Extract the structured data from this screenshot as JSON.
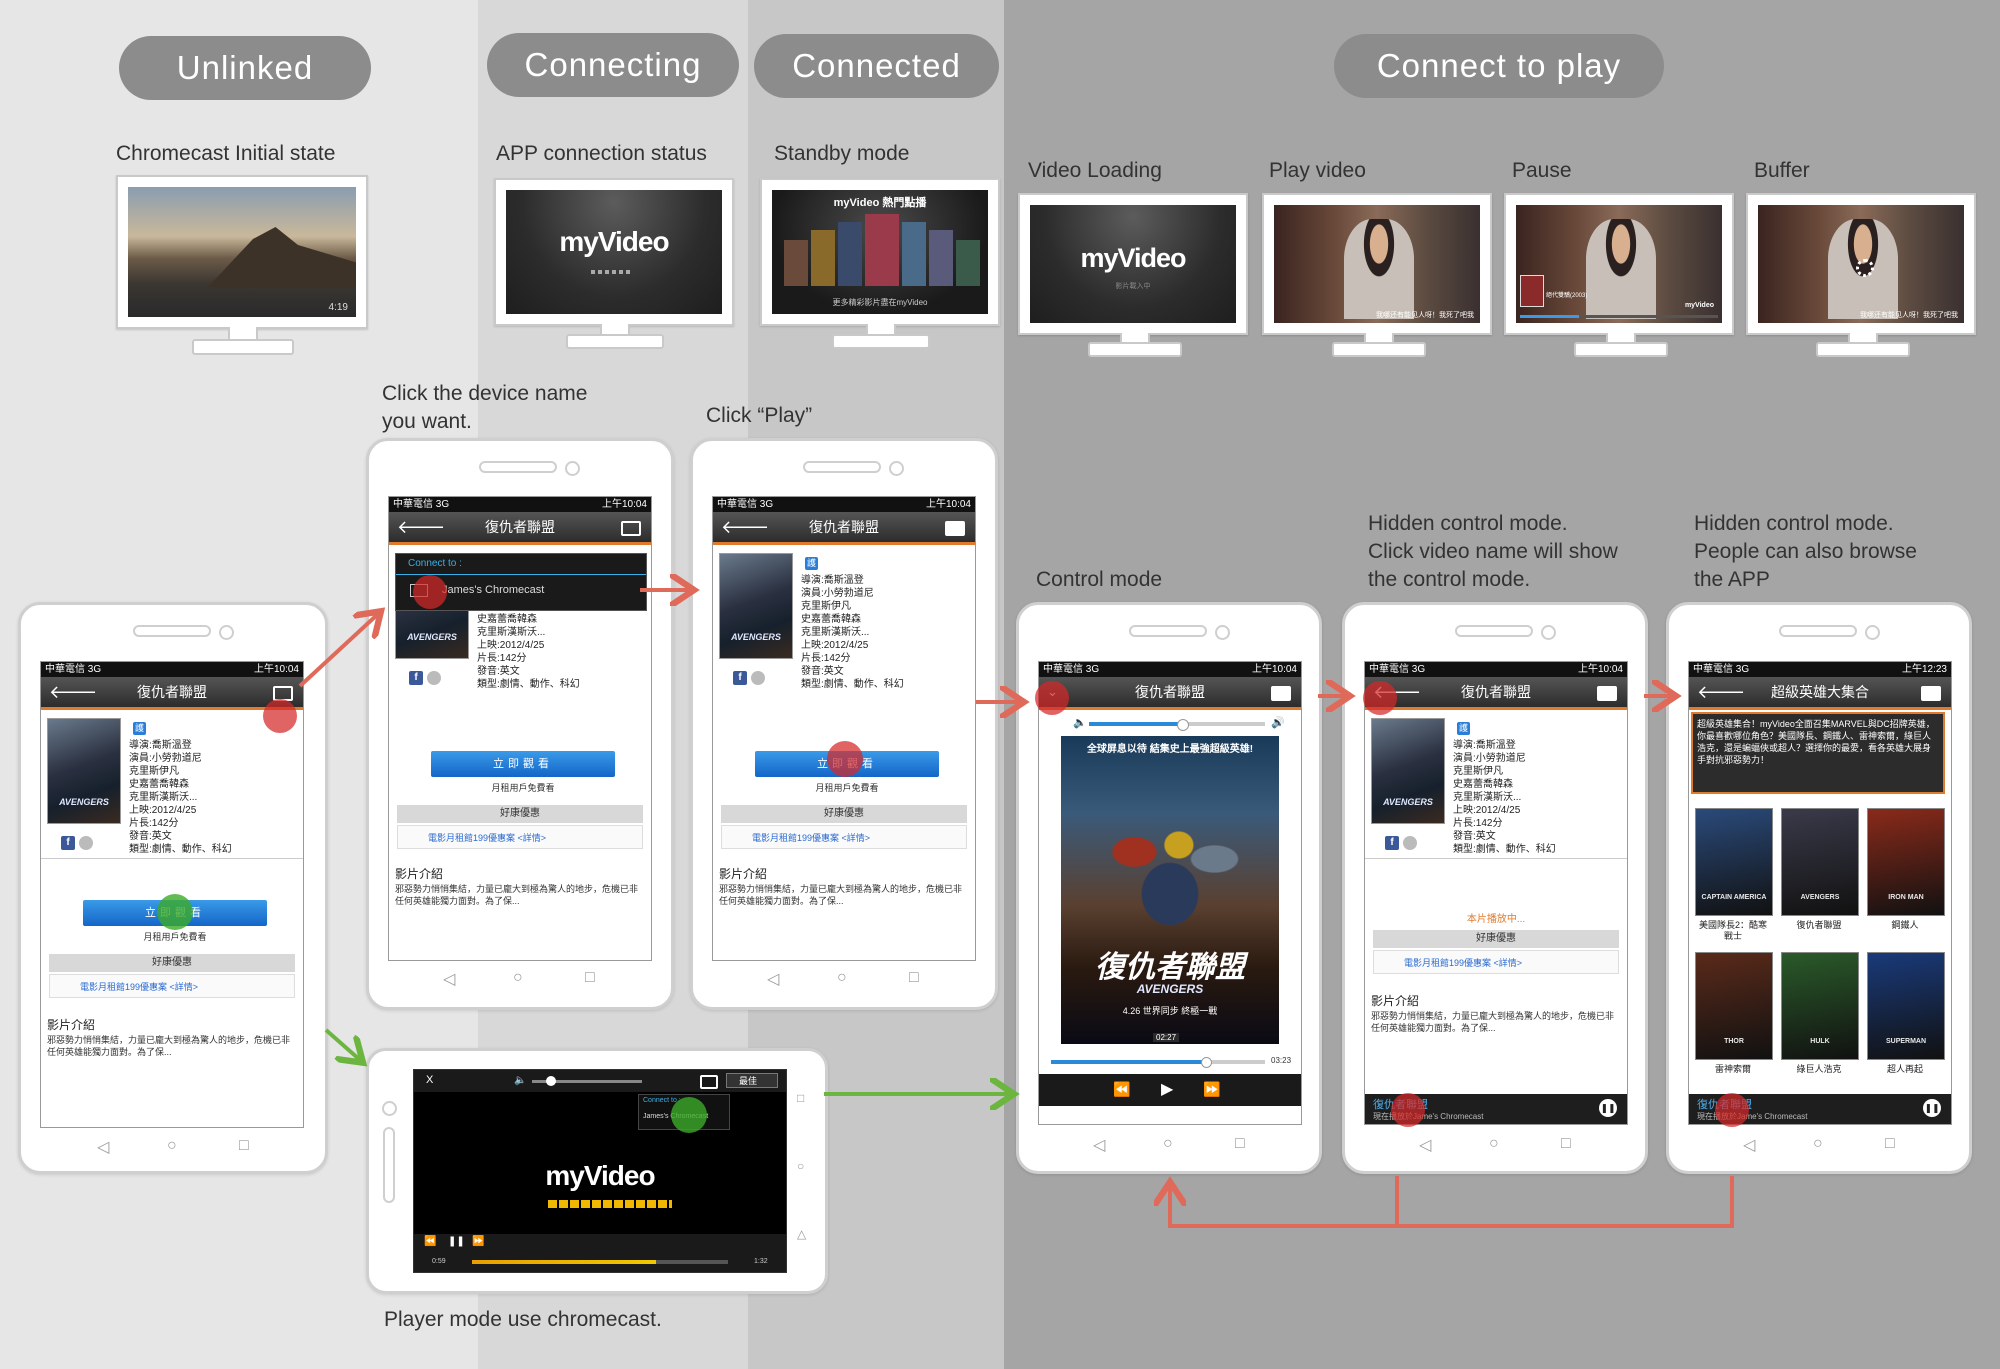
{
  "stages": {
    "unlinked": "Unlinked",
    "connecting": "Connecting",
    "connected": "Connected",
    "connect_to_play": "Connect to play"
  },
  "captions": {
    "chromecast_initial": "Chromecast Initial state",
    "app_connection": "APP connection status",
    "standby": "Standby mode",
    "video_loading": "Video Loading",
    "play_video": "Play video",
    "pause": "Pause",
    "buffer": "Buffer",
    "click_device_1": "Click the device name",
    "click_device_2": "you want.",
    "click_play": "Click “Play”",
    "control_mode": "Control mode",
    "hidden1_1": "Hidden control mode.",
    "hidden1_2": "Click video name will show",
    "hidden1_3": "the control mode.",
    "hidden2_1": "Hidden control mode.",
    "hidden2_2": "People can also browse",
    "hidden2_3": "the APP",
    "player_mode": "Player mode use chromecast."
  },
  "tv": {
    "clock": "4:19",
    "brand": "myVideo",
    "standby_title": "myVideo 熱門點播",
    "standby_sub": "更多精彩影片盡在myVideo",
    "loading_sub": "影片載入中",
    "subtitle": "我哪还有能见人呀！我死了吧我",
    "pause_title": "絕代雙驕(2003)",
    "pause_brand": "myVideo"
  },
  "phone_status": {
    "carrier": "中華電信 3G",
    "time": "上午10:04",
    "time_alt": "上午12:23"
  },
  "movie": {
    "title": "復仇者聯盟",
    "poster_text": "AVENGERS",
    "badge": "護",
    "info_lines": [
      "導演:喬斯溫登",
      "演員:小勞勃道尼",
      "克里斯伊凡",
      "史嘉蕾喬韓森",
      "克里斯漢斯沃...",
      "上映:2012/4/25",
      "片長:142分",
      "發音:英文",
      "類型:劇情、動作、科幻"
    ],
    "fb": "f",
    "watch_btn": "立即觀看",
    "free_text": "月租用戶免費看",
    "promo_header": "好康優惠",
    "promo_link": "電影月租館199優惠案 <詳情>",
    "intro_header": "影片介紹",
    "intro_text": "邪惡勢力悄悄集結，力量已龐大到極為驚人的地步，危機已非任何英雄能獨力面對。為了保...",
    "playing": "本片播放中...",
    "connect_to": "Connect to :",
    "device": "James's Chromecast",
    "device_short": "Jame's Chromecast",
    "now_playing": "現在播放於Jame's Chromecast"
  },
  "control": {
    "poster_top": "全球屏息以待 結集史上最強超級英雄!",
    "poster_title": "復仇者聯盟",
    "poster_sub": "AVENGERS",
    "poster_date": "4.26 世界同步 終極一戰",
    "elapsed": "02:27",
    "total": "03:23"
  },
  "browse": {
    "title": "超級英雄大集合",
    "desc": "超級英雄集合！myVideo全面召集MARVEL與DC招牌英雄，你最喜歡哪位角色？美國隊長、鋼鐵人、雷神索爾，綠巨人浩克，還是蝙蝠俠或超人？選擇你的最愛，看各英雄大展身手對抗邪惡勢力！",
    "movies": [
      "美國隊長2：酷寒戰士",
      "復仇者聯盟",
      "鋼鐵人",
      "雷神索爾",
      "綠巨人浩克",
      "超人再起"
    ],
    "posters": [
      "CAPTAIN AMERICA",
      "AVENGERS",
      "IRON MAN",
      "THOR",
      "HULK",
      "SUPERMAN"
    ]
  },
  "player": {
    "close": "X",
    "quality": "最佳",
    "connect_to": "Connect to :",
    "device": "James's Chromecast",
    "brand": "myVideo",
    "start": "0:59",
    "end": "1:32",
    "progress": 0.72
  },
  "colors": {
    "red_arrow": "#e06a5a",
    "green_arrow": "#6cb640",
    "accent": "#e07a2c"
  }
}
